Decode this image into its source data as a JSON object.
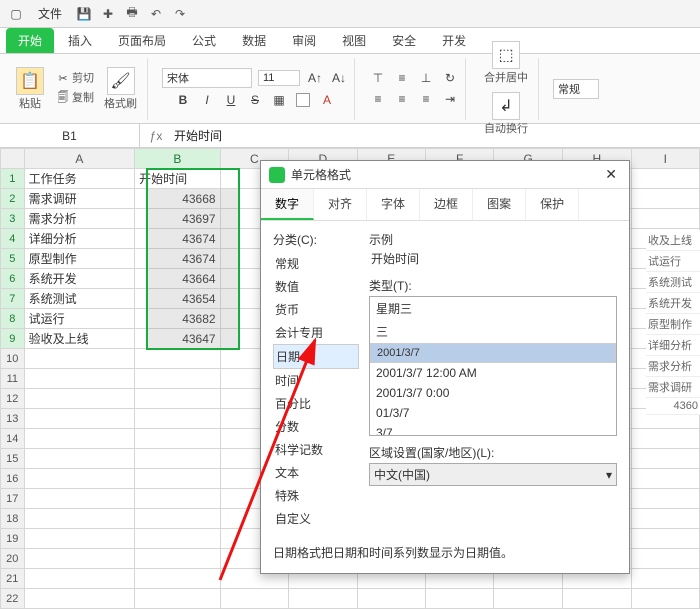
{
  "titlebar": {
    "file_menu": "文件"
  },
  "ribbon": {
    "tabs": [
      "开始",
      "插入",
      "页面布局",
      "公式",
      "数据",
      "审阅",
      "视图",
      "安全",
      "开发"
    ],
    "active_tab_index": 0,
    "paste_label": "粘贴",
    "cut_label": "剪切",
    "copy_label": "复制",
    "format_painter_label": "格式刷",
    "font_name": "宋体",
    "font_size": "11",
    "merge_center_label": "合并居中",
    "wrap_label": "自动换行",
    "style_label": "常规"
  },
  "cellref": {
    "ref": "B1",
    "formula": "开始时间"
  },
  "columns": [
    "A",
    "B",
    "C",
    "D",
    "E",
    "F",
    "G",
    "H",
    "I"
  ],
  "rows": [
    "1",
    "2",
    "3",
    "4",
    "5",
    "6",
    "7",
    "8",
    "9",
    "10",
    "11",
    "12",
    "13",
    "14",
    "15",
    "16",
    "17",
    "18",
    "19",
    "20",
    "21",
    "22"
  ],
  "table": {
    "colA": [
      "工作任务",
      "需求调研",
      "需求分析",
      "详细分析",
      "原型制作",
      "系统开发",
      "系统测试",
      "试运行",
      "验收及上线"
    ],
    "colB_header": "开始时间",
    "colB": [
      "43668",
      "43697",
      "43674",
      "43674",
      "43664",
      "43654",
      "43682",
      "43647"
    ]
  },
  "dialog": {
    "title": "单元格格式",
    "tabs": [
      "数字",
      "对齐",
      "字体",
      "边框",
      "图案",
      "保护"
    ],
    "active_tab_index": 0,
    "category_label": "分类(C):",
    "categories": [
      "常规",
      "数值",
      "货币",
      "会计专用",
      "日期",
      "时间",
      "百分比",
      "分数",
      "科学记数",
      "文本",
      "特殊",
      "自定义"
    ],
    "selected_category_index": 4,
    "sample_label": "示例",
    "sample_value": "开始时间",
    "type_label": "类型(T):",
    "types": [
      "星期三",
      "三",
      "2001/3/7",
      "2001/3/7 12:00 AM",
      "2001/3/7 0:00",
      "01/3/7",
      "3/7"
    ],
    "selected_type_index": 2,
    "locale_label": "区域设置(国家/地区)(L):",
    "locale_value": "中文(中国)",
    "footer_text": "日期格式把日期和时间系列数显示为日期值。"
  },
  "peek": {
    "items": [
      "收及上线",
      "试运行",
      "系统测试",
      "系统开发",
      "原型制作",
      "详细分析",
      "需求分析",
      "需求调研"
    ],
    "tail": "4360"
  }
}
